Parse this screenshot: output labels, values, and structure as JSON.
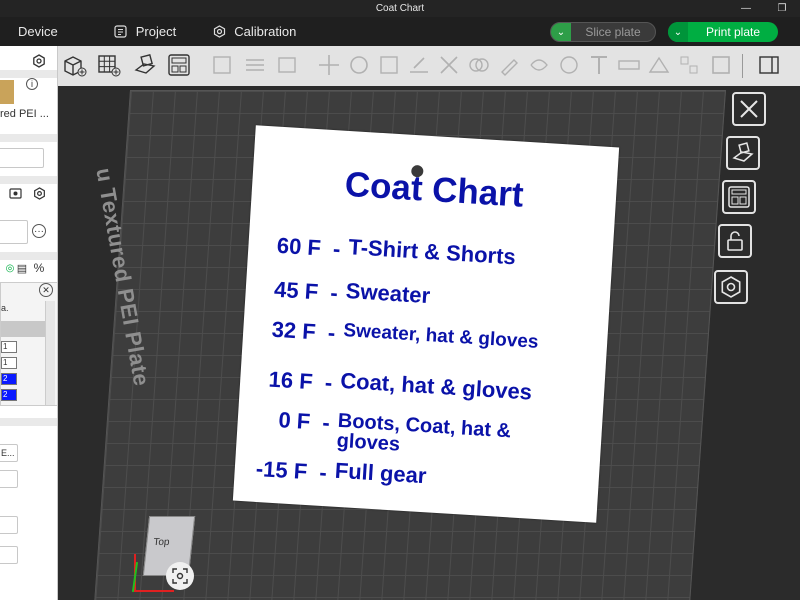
{
  "window": {
    "title": "Coat Chart"
  },
  "menu": {
    "device": "Device",
    "project": "Project",
    "calibration": "Calibration"
  },
  "actions": {
    "slice_label": "Slice plate",
    "print_label": "Print plate"
  },
  "left_panel": {
    "plate_type_partial": "red PEI ...",
    "filament_header_partial": "a.",
    "filament_slots": [
      "1",
      "1",
      "2",
      "2"
    ],
    "process_partial": "E..."
  },
  "colors": {
    "accent_green": "#00ae42",
    "model_text": "#0a12a8",
    "filament_blue": "#0a1aff"
  },
  "viewport": {
    "plate_label": "u Textured PEI Plate",
    "view_cube_label": "Top"
  },
  "model": {
    "title": "Coat Chart",
    "rows": [
      {
        "temp": "60  F",
        "dash": "-",
        "text": "T-Shirt & Shorts"
      },
      {
        "temp": "45  F",
        "dash": "-",
        "text": "Sweater"
      },
      {
        "temp": "32  F",
        "dash": "-",
        "text": "Sweater, hat & gloves"
      },
      {
        "temp": "16  F",
        "dash": "-",
        "text": "Coat, hat & gloves"
      },
      {
        "temp": "0  F",
        "dash": "-",
        "text": "Boots, Coat, hat & gloves"
      },
      {
        "temp": "-15  F",
        "dash": "-",
        "text": "Full gear"
      }
    ]
  }
}
